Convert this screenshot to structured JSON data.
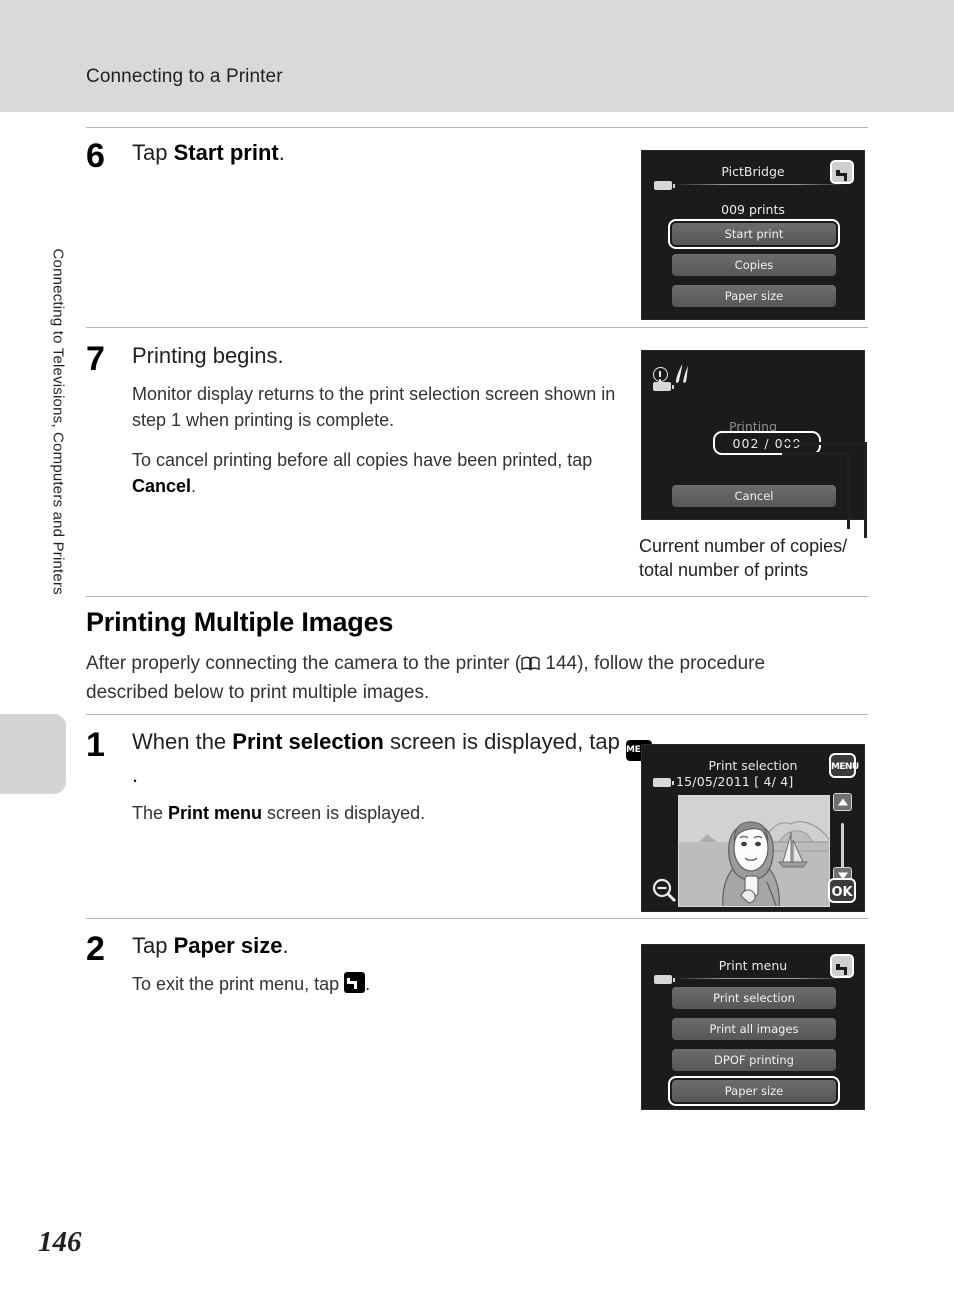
{
  "header": {
    "title": "Connecting to a Printer"
  },
  "side": {
    "chapter": "Connecting to Televisions, Computers and Printers"
  },
  "folio": {
    "page": "146"
  },
  "steps": [
    {
      "num": "6",
      "title_pre": "Tap ",
      "title_bold": "Start print",
      "title_post": "."
    },
    {
      "num": "7",
      "title_pre": "Printing begins.",
      "sub1": "Monitor display returns to the print selection screen shown in step 1 when printing is complete.",
      "sub2_pre": "To cancel printing before all copies have been printed, tap ",
      "sub2_bold": "Cancel",
      "sub2_post": "."
    }
  ],
  "section": {
    "heading": "Printing Multiple Images",
    "intro_pre": "After properly connecting the camera to the printer (",
    "intro_ref": "144",
    "intro_post": "), follow the procedure described below to print multiple images."
  },
  "steps2": [
    {
      "num": "1",
      "title_pre": "When the ",
      "title_bold": "Print selection",
      "title_mid": " screen is displayed, tap ",
      "icon": "menu-icon",
      "icon_label": "MENU",
      "title_post": ".",
      "sub_pre": "The ",
      "sub_bold": "Print menu",
      "sub_post": " screen is displayed."
    },
    {
      "num": "2",
      "title_pre": "Tap ",
      "title_bold": "Paper size",
      "title_post": ".",
      "sub_pre": "To exit the print menu, tap ",
      "icon": "back-icon",
      "sub_post": "."
    }
  ],
  "callout": {
    "line1": "Current number of copies/",
    "line2": "total number of prints"
  },
  "screens": {
    "pictbridge": {
      "title": "PictBridge",
      "prints": "009 prints",
      "buttons": [
        "Start print",
        "Copies",
        "Paper size"
      ],
      "highlighted": "Start print",
      "back_icon": "back-key-icon",
      "battery_icon": "battery-icon"
    },
    "printing": {
      "label": "Printing",
      "count": "002  /  009",
      "cancel": "Cancel",
      "warn_icons": [
        "exclamation-icon",
        "blur-warning-icon"
      ],
      "battery_icon": "battery-icon"
    },
    "print_selection": {
      "title": "Print selection",
      "date": "15/05/2011",
      "counter": "[     4/     4]",
      "menu_key": "MENU",
      "ok_key": "OK",
      "battery_icon": "battery-icon",
      "zoom_icon": "zoom-out-icon",
      "up_icon": "arrow-up-icon",
      "down_icon": "arrow-down-icon"
    },
    "print_menu": {
      "title": "Print menu",
      "buttons": [
        "Print selection",
        "Print all images",
        "DPOF printing",
        "Paper size"
      ],
      "highlighted": "Paper size",
      "back_icon": "back-key-icon",
      "battery_icon": "battery-icon"
    }
  },
  "colors": {
    "header_bg": "#d9d9d9",
    "screen_bg": "#1b1b1b",
    "button_fill": "#6d6d6d",
    "rule": "#b5b5b5"
  }
}
